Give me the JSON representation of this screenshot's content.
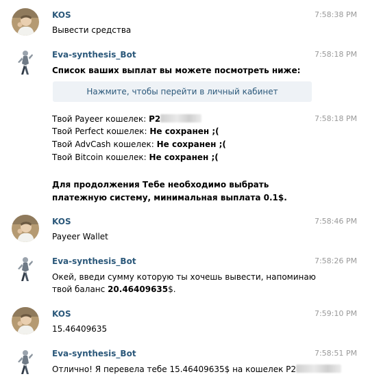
{
  "messages": [
    {
      "author": "KOS",
      "time": "7:58:38 PM",
      "text": "Вывести средства"
    },
    {
      "author": "Eva-synthesis_Bot",
      "time": "7:58:18 PM",
      "heading": "Список ваших выплат вы можете посмотреть ниже:",
      "button_label": "Нажмите, чтобы перейти в личный кабинет"
    },
    {
      "time": "7:58:18 PM",
      "wallets": [
        {
          "label": "Твой Payeer кошелек: ",
          "value": "P2"
        },
        {
          "label": "Твой Perfect кошелек: ",
          "value": "Не сохранен ;("
        },
        {
          "label": "Твой AdvCash кошелек: ",
          "value": "Не сохранен ;("
        },
        {
          "label": "Твой Bitcoin кошелек: ",
          "value": "Не сохранен ;("
        }
      ],
      "note_line1": "Для продолжения Тебе необходимо выбрать",
      "note_line2": "платежную систему, минимальная выплата 0.1$."
    },
    {
      "author": "KOS",
      "time": "7:58:46 PM",
      "text": "Payeer Wallet"
    },
    {
      "author": "Eva-synthesis_Bot",
      "time": "7:58:26 PM",
      "line1": "Окей, введи сумму которую ты хочешь вывести, напоминаю",
      "line2_prefix": "твой баланс ",
      "line2_amount": "20.46409635",
      "line2_suffix": "$."
    },
    {
      "author": "KOS",
      "time": "7:59:10 PM",
      "text": "15.46409635"
    },
    {
      "author": "Eva-synthesis_Bot",
      "time": "7:58:51 PM",
      "text": "Отлично! Я перевела тебе 15.46409635$ на кошелек P2"
    }
  ]
}
